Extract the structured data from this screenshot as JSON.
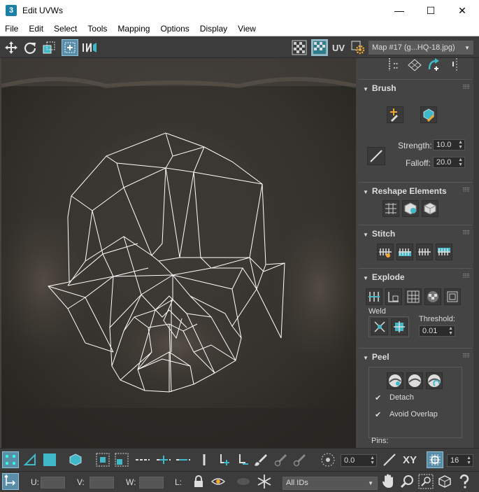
{
  "window": {
    "app_icon_text": "3",
    "title": "Edit UVWs",
    "minimize_glyph": "—",
    "maximize_glyph": "☐",
    "close_glyph": "✕"
  },
  "menu": [
    "File",
    "Edit",
    "Select",
    "Tools",
    "Mapping",
    "Options",
    "Display",
    "View"
  ],
  "toolbar": {
    "uv_label": "UV",
    "map_select": "Map #17 (g...HQ-18.jpg)"
  },
  "brush": {
    "title": "Brush",
    "strength_label": "Strength:",
    "strength_value": "10.0",
    "falloff_label": "Falloff:",
    "falloff_value": "20.0"
  },
  "reshape": {
    "title": "Reshape Elements"
  },
  "stitch": {
    "title": "Stitch"
  },
  "explode": {
    "title": "Explode",
    "weld_label": "Weld",
    "threshold_label": "Threshold:",
    "threshold_value": "0.01"
  },
  "peel": {
    "title": "Peel",
    "detach_label": "Detach",
    "detach_checked": true,
    "avoid_overlap_label": "Avoid Overlap",
    "avoid_overlap_checked": true,
    "pins_label": "Pins:"
  },
  "bottom": {
    "angle_value": "0.0",
    "xy_label": "XY",
    "grid_value": "16",
    "u_label": "U:",
    "v_label": "V:",
    "w_label": "W:",
    "l_label": "L:",
    "ids_select": "All IDs"
  },
  "colors": {
    "accent_teal": "#3fb8c8",
    "active_blue": "#5a8ea8",
    "panel_bg": "#444444",
    "wire": "#ffffff"
  }
}
